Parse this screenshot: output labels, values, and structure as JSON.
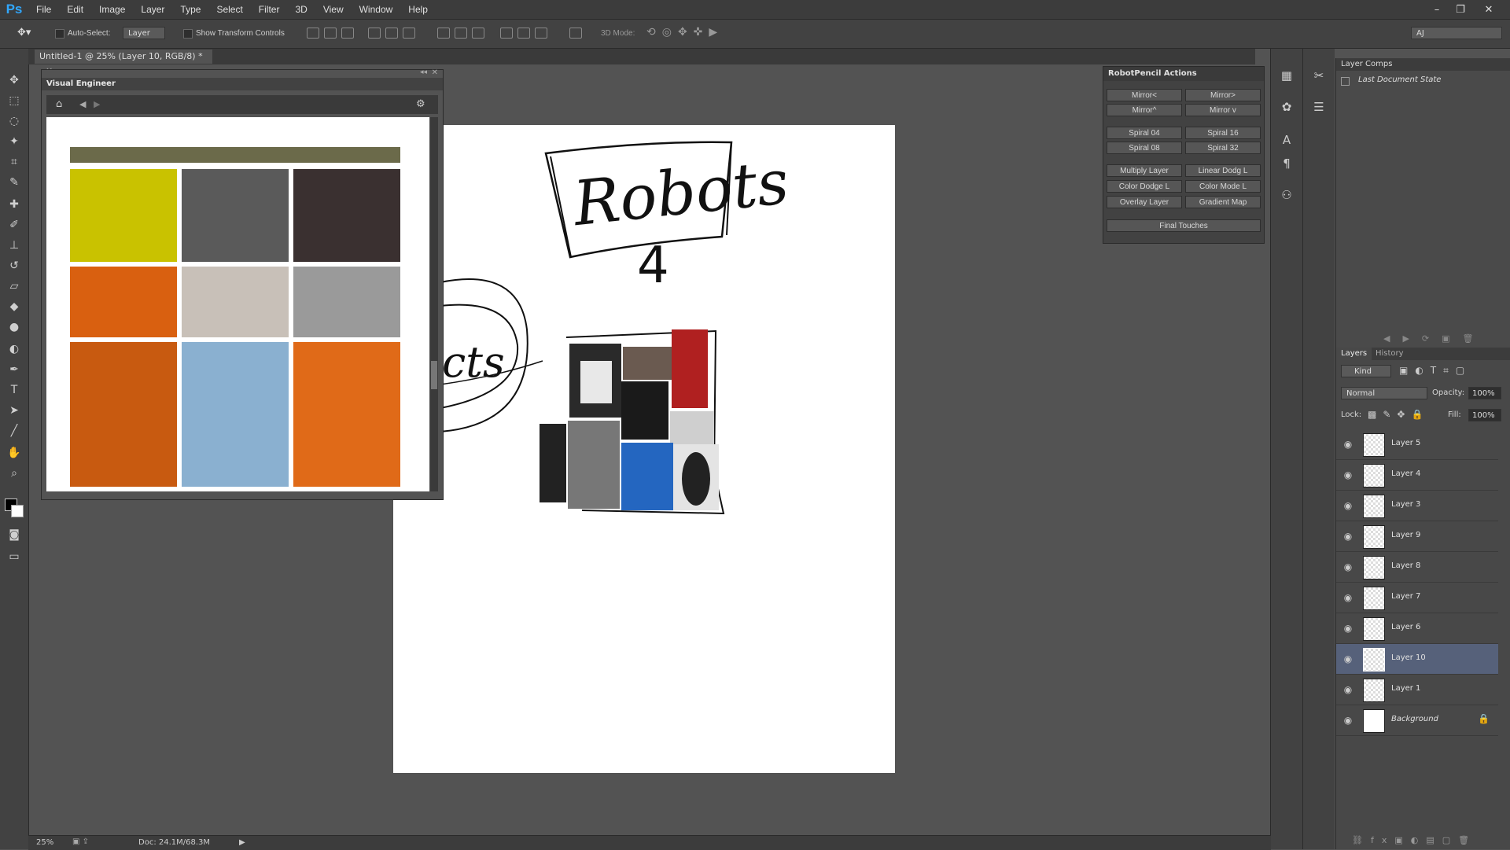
{
  "app": {
    "logo": "Ps"
  },
  "menu": [
    "File",
    "Edit",
    "Image",
    "Layer",
    "Type",
    "Select",
    "Filter",
    "3D",
    "View",
    "Window",
    "Help"
  ],
  "window_controls": {
    "minimize": "–",
    "restore": "❐",
    "close": "✕"
  },
  "options_bar": {
    "auto_select": "Auto-Select:",
    "layer_select": "Layer",
    "show_transform": "Show Transform Controls",
    "mode_3d": "3D Mode:",
    "workspace": "AJ"
  },
  "document_tab": "Untitled-1 @ 25% (Layer 10, RGB/8) *",
  "visual_engineer": {
    "title": "Visual Engineer"
  },
  "canvas_sketch": {
    "title": "Robots",
    "number": "4",
    "partial": "cts"
  },
  "robotpencil": {
    "title": "RobotPencil Actions",
    "buttons": [
      [
        "Mirror<",
        "Mirror>"
      ],
      [
        "Mirror^",
        "Mirror v"
      ],
      [
        "Spiral 04",
        "Spiral 16"
      ],
      [
        "Spiral 08",
        "Spiral 32"
      ],
      [
        "Multiply Layer",
        "Linear Dodg L"
      ],
      [
        "Color Dodge L",
        "Color Mode L"
      ],
      [
        "Overlay Layer",
        "Gradient Map"
      ]
    ],
    "final": "Final Touches"
  },
  "layer_comps": {
    "title": "Layer Comps",
    "state": "Last Document State"
  },
  "layers_panel": {
    "tabs": [
      "Layers",
      "History"
    ],
    "filter": "Kind",
    "blend": "Normal",
    "opacity_label": "Opacity:",
    "opacity": "100%",
    "lock_label": "Lock:",
    "fill_label": "Fill:",
    "fill": "100%",
    "layers": [
      "Layer 5",
      "Layer 4",
      "Layer 3",
      "Layer 9",
      "Layer 8",
      "Layer 7",
      "Layer 6",
      "Layer 10",
      "Layer 1",
      "Background"
    ],
    "selected": "Layer 10"
  },
  "status": {
    "zoom": "25%",
    "doc": "Doc: 24.1M/68.3M"
  },
  "colors": {
    "accent": "#31a8ff",
    "selected_layer": "#56617a",
    "panel": "#424242"
  }
}
